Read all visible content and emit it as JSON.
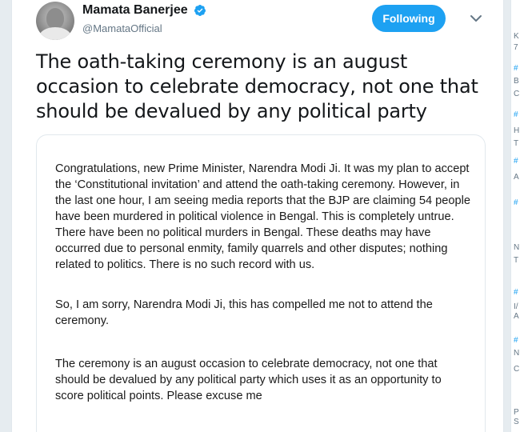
{
  "tweet": {
    "author_name": "Mamata Banerjee",
    "author_handle": "@MamataOfficial",
    "follow_button_label": "Following",
    "text": "The oath-taking ceremony is an august occasion to celebrate democracy, not one that should be devalued by any political party",
    "verified": true
  },
  "letter": {
    "paragraph_1": "Congratulations, new Prime Minister, Narendra Modi Ji. It was my plan to accept the ‘Constitutional invitation’ and attend the oath-taking ceremony. However, in the last one hour, I am seeing media reports that the BJP are claiming 54 people have been murdered in political violence in Bengal. This is completely untrue. There have been no political murders in Bengal. These deaths may have occurred due to personal enmity, family quarrels and other disputes; nothing related to politics. There is no such record with us.",
    "paragraph_2": "So, I am sorry, Narendra Modi Ji, this has compelled me not to attend the ceremony.",
    "paragraph_3": "The ceremony is an august occasion to celebrate democracy, not one that should be devalued by any political party which uses it as an opportunity to score political points. Please excuse me"
  },
  "side_strip": {
    "items": [
      "K",
      "7",
      "#",
      "B",
      "C",
      "#",
      "H",
      "T",
      "#",
      "A",
      "#",
      "N",
      "T",
      "#",
      "I/",
      "A",
      "#",
      "N",
      "C",
      "P",
      "S"
    ]
  },
  "colors": {
    "accent": "#1da1f2",
    "text": "#14171a",
    "muted": "#657786"
  },
  "icons": {
    "verified": "verified-badge-icon",
    "caret": "chevron-down-icon"
  }
}
